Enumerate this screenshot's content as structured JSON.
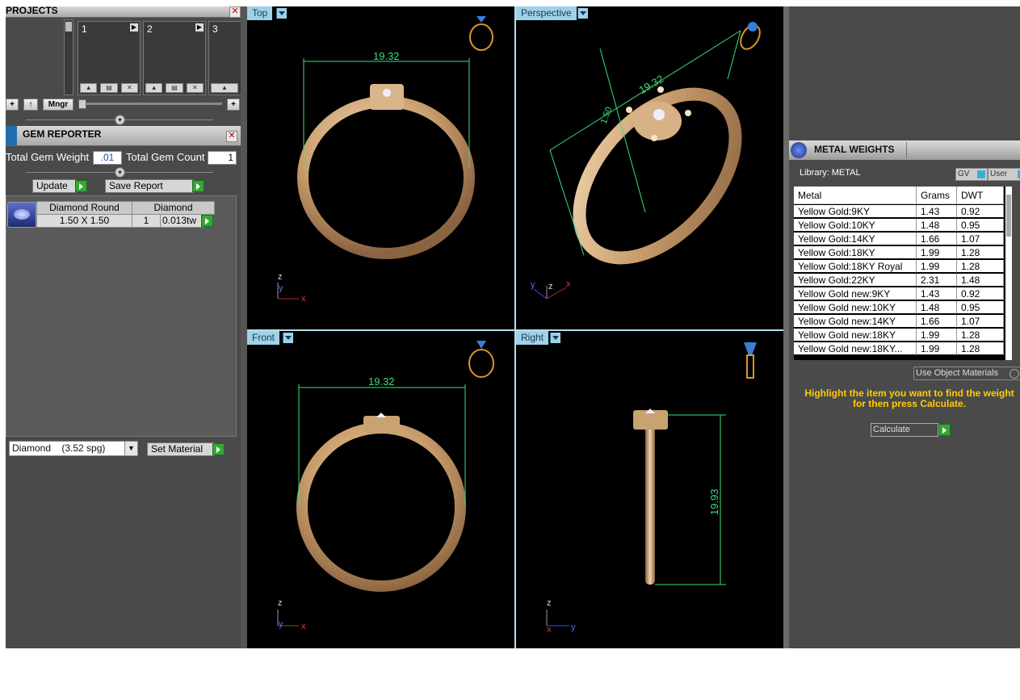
{
  "projects": {
    "title": "PROJECTS",
    "slots": [
      {
        "num": "1"
      },
      {
        "num": "2"
      },
      {
        "num": "3"
      }
    ],
    "toolbar": {
      "add": "+",
      "up": "↑",
      "mngr": "Mngr",
      "right_add": "+"
    }
  },
  "gem_reporter": {
    "title": "GEM REPORTER",
    "total_weight_label": "Total Gem Weight",
    "total_weight_value": ".01",
    "total_count_label": "Total Gem Count",
    "total_count_value": "1",
    "update_label": "Update",
    "save_report_label": "Save Report",
    "table": {
      "headers": [
        "Diamond Round",
        "Diamond"
      ],
      "row": {
        "size": "1.50 X 1.50",
        "count": "1",
        "weight": "0.013tw"
      }
    },
    "material_select": "Diamond    (3.52 spg)",
    "set_material_label": "Set Material"
  },
  "viewports": {
    "top": {
      "label": "Top",
      "dimension": "19.32"
    },
    "perspective": {
      "label": "Perspective",
      "dimension": "19.32",
      "dimension2": "1.50"
    },
    "front": {
      "label": "Front",
      "dimension": "19.32"
    },
    "right": {
      "label": "Right",
      "dimension": "19.93"
    },
    "axes": {
      "z": "z",
      "y": "y",
      "x": "x"
    }
  },
  "metal_weights": {
    "title": "METAL WEIGHTS",
    "library_label": "Library: METAL",
    "gv_label": "GV",
    "user_label": "User",
    "columns": [
      "Metal",
      "Grams",
      "DWT"
    ],
    "rows": [
      {
        "metal": "Yellow Gold:9KY",
        "grams": "1.43",
        "dwt": "0.92"
      },
      {
        "metal": "Yellow Gold:10KY",
        "grams": "1.48",
        "dwt": "0.95"
      },
      {
        "metal": "Yellow Gold:14KY",
        "grams": "1.66",
        "dwt": "1.07"
      },
      {
        "metal": "Yellow Gold:18KY",
        "grams": "1.99",
        "dwt": "1.28"
      },
      {
        "metal": "Yellow Gold:18KY Royal",
        "grams": "1.99",
        "dwt": "1.28"
      },
      {
        "metal": "Yellow Gold:22KY",
        "grams": "2.31",
        "dwt": "1.48"
      },
      {
        "metal": "Yellow Gold new:9KY",
        "grams": "1.43",
        "dwt": "0.92"
      },
      {
        "metal": "Yellow Gold new:10KY",
        "grams": "1.48",
        "dwt": "0.95"
      },
      {
        "metal": "Yellow Gold new:14KY",
        "grams": "1.66",
        "dwt": "1.07"
      },
      {
        "metal": "Yellow Gold new:18KY",
        "grams": "1.99",
        "dwt": "1.28"
      },
      {
        "metal": "Yellow Gold new:18KY...",
        "grams": "1.99",
        "dwt": "1.28"
      }
    ],
    "use_object_materials": "Use Object Materials",
    "instruction": "Highlight the item you want to find the weight for then press Calculate.",
    "calculate_label": "Calculate"
  },
  "colors": {
    "panel_bg": "#4a4a4a",
    "viewport_bg": "#000000",
    "tab_bg": "#9fd2e8",
    "dimension_line": "#39e07c",
    "ring_gold": "#c9a070",
    "instruction_text": "#ffcc00",
    "go_button": "#34a834"
  }
}
